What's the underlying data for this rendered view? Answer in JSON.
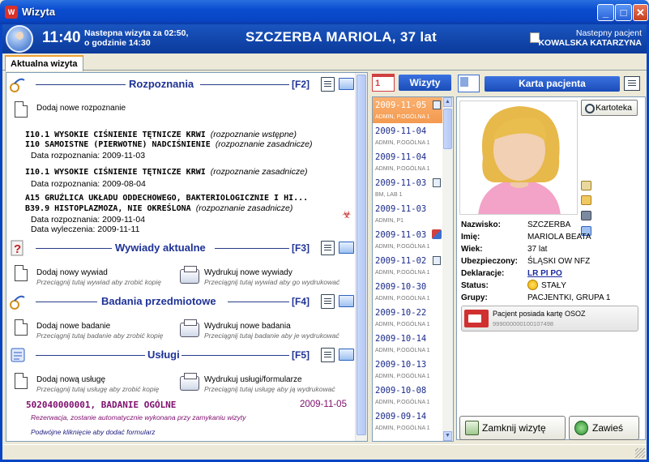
{
  "window": {
    "title": "Wizyta",
    "minimize": "_",
    "maximize": "□",
    "close": "✕"
  },
  "header": {
    "time": "11:40",
    "next_visit_line1": "Nastepna wizyta za 02:50,",
    "next_visit_line2": "o godzinie 14:30",
    "patient_title": "SZCZERBA MARIOLA, 37 lat",
    "next_patient_label": "Nastepny pacjent",
    "next_patient_name": "KOWALSKA KATARZYNA"
  },
  "tabs": {
    "current": "Aktualna wizyta"
  },
  "sections": {
    "rozpoznania": {
      "title": "Rozpoznania",
      "fkey": "[F2]",
      "add": "Dodaj nowe rozpoznanie"
    },
    "wywiady": {
      "title": "Wywiady aktualne",
      "fkey": "[F3]",
      "add": "Dodaj nowy wywiad",
      "add_hint": "Przeciągnij tutaj wywiad aby zrobić kopię",
      "print": "Wydrukuj nowe wywiady",
      "print_hint": "Przeciągnij tutaj wywiad aby go wydrukować"
    },
    "badania": {
      "title": "Badania przedmiotowe",
      "fkey": "[F4]",
      "add": "Dodaj nowe badanie",
      "add_hint": "Przeciągnij tutaj badanie aby zrobić kopię",
      "print": "Wydrukuj nowe badania",
      "print_hint": "Przeciągnij tutaj badanie aby je wydrukować"
    },
    "uslugi": {
      "title": "Usługi",
      "fkey": "[F5]",
      "add": "Dodaj nową usługę",
      "add_hint": "Przeciągnij tutaj usługę aby zrobić kopię",
      "print": "Wydrukuj usługi/formularze",
      "print_hint": "Przeciągnij tutaj usługę aby ją wydrukować"
    }
  },
  "diagnoses": [
    {
      "line1_code": "I10.1 WYSOKIE CIŚNIENIE TĘTNICZE KRWI",
      "line1_note": "(rozpoznanie wstępne)",
      "line2_code": "I10 SAMOISTNE (PIERWOTNE) NADCIŚNIENIE",
      "line2_note": "(rozpoznanie zasadnicze)",
      "date": "Data rozpoznania: 2009-11-03"
    },
    {
      "line1_code": "I10.1 WYSOKIE CIŚNIENIE TĘTNICZE KRWI",
      "line1_note": "(rozpoznanie zasadnicze)",
      "date": "Data rozpoznania: 2009-08-04"
    },
    {
      "line1_code": "A15 GRUŹLICA UKŁADU ODDECHOWEGO, BAKTERIOLOGICZNIE I HI...",
      "line2_code": "B39.9 HISTOPLAZMOZA, NIE OKREŚLONA",
      "line2_note": "(rozpoznanie zasadnicze)",
      "date": "Data rozpoznania: 2009-11-04",
      "date2": "Data wyleczenia: 2009-11-11"
    }
  ],
  "service": {
    "code": "502040000001, BADANIE OGÓLNE",
    "date": "2009-11-05",
    "note1": "Rezerwacja, zostanie automatycznie wykonana przy zamykaniu wizyty",
    "note2": "Podwójne kliknięcie aby dodać formularz"
  },
  "visits": {
    "header": "Wizyty",
    "calendar_icon_text": "1",
    "items": [
      {
        "date": "2009-11-05",
        "sub": "ADMIN, P.OGÓLNA 1"
      },
      {
        "date": "2009-11-04",
        "sub": "ADMIN, P.OGÓLNA 1"
      },
      {
        "date": "2009-11-04",
        "sub": "ADMIN, P.OGÓLNA 1"
      },
      {
        "date": "2009-11-03",
        "sub": "BM, LAB 1"
      },
      {
        "date": "2009-11-03",
        "sub": "ADMIN, P1"
      },
      {
        "date": "2009-11-03",
        "sub": "ADMIN, P.OGÓLNA 1"
      },
      {
        "date": "2009-11-02",
        "sub": "ADMIN, P.OGÓLNA 1"
      },
      {
        "date": "2009-10-30",
        "sub": "ADMIN, P.OGÓLNA 1"
      },
      {
        "date": "2009-10-22",
        "sub": "ADMIN, P.OGÓLNA 1"
      },
      {
        "date": "2009-10-14",
        "sub": "ADMIN, P.OGÓLNA 1"
      },
      {
        "date": "2009-10-13",
        "sub": "ADMIN, P.OGÓLNA 1"
      },
      {
        "date": "2009-10-08",
        "sub": "ADMIN, P.OGÓLNA 1"
      },
      {
        "date": "2009-09-14",
        "sub": "ADMIN, P.OGÓLNA 1"
      }
    ]
  },
  "patient_card": {
    "header": "Karta pacjenta",
    "kartoteka": "Kartoteka",
    "fields": [
      {
        "label": "Nazwisko:",
        "value": "SZCZERBA"
      },
      {
        "label": "Imię:",
        "value": "MARIOLA BEATA"
      },
      {
        "label": "Wiek:",
        "value": "37 lat"
      },
      {
        "label": "Ubezpieczony:",
        "value": "ŚLĄSKI OW NFZ"
      },
      {
        "label": "Deklaracje:",
        "value": "LR PI PO"
      },
      {
        "label": "Status:",
        "value": "STAŁY"
      },
      {
        "label": "Grupy:",
        "value": "PACJENTKI, GRUPA 1"
      }
    ],
    "osoz_line1": "Pacjent posiada kartę OSOZ",
    "osoz_line2": "999000000100107498"
  },
  "buttons": {
    "close_visit": "Zamknij wizytę",
    "suspend": "Zawieś"
  },
  "colors": {
    "title_blue": "#1e3296",
    "selected_visit": "#f39a50",
    "service_purple": "#801070"
  }
}
